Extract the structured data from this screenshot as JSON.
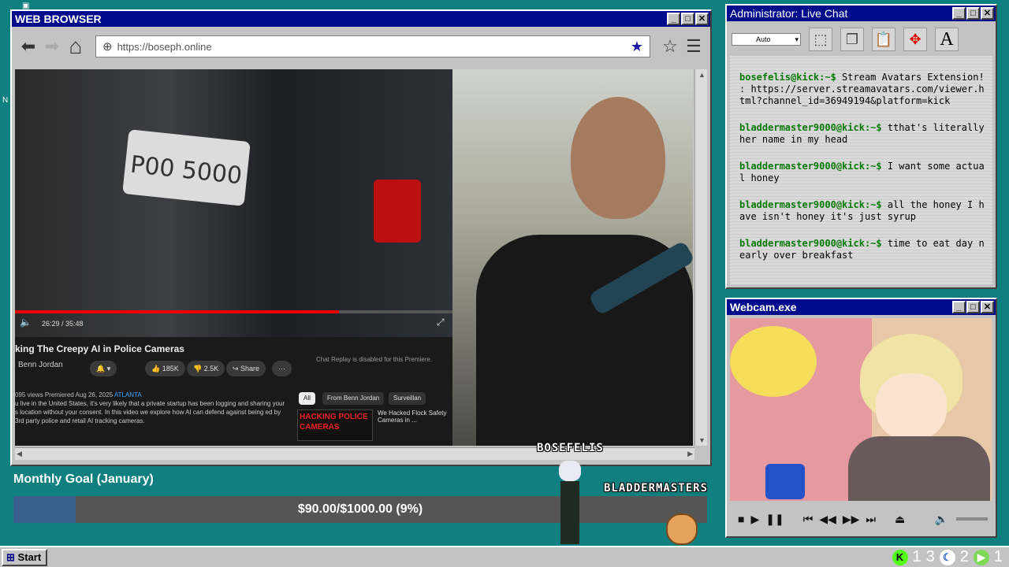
{
  "browser": {
    "title": "WEB BROWSER",
    "url": "https://boseph.online",
    "nav": {
      "back": "⬅",
      "forward": "➡",
      "home": "⌂"
    }
  },
  "video": {
    "plate_text": "P00 5000",
    "time": "26:29 / 35:48",
    "progress": 0.74,
    "title": "king The Creepy AI in Police Cameras",
    "channel": "Benn Jordan",
    "likes": "185K",
    "dislikes": "2.5K",
    "share": "Share",
    "chat_note": "Chat Replay is disabled for this Premiere.",
    "views": "095 views",
    "premiered": "Premiered Aug 26, 2025",
    "location": "ATLANTA",
    "description": "u live in the United States, it's very likely that a private startup has been logging and sharing your s location without your consent. In this video we explore how AI can defend against being ed by 3rd party police and retail AI tracking cameras.",
    "filters": [
      "All",
      "From Benn Jordan",
      "Surveillan"
    ],
    "thumb_text": "HACKING POLICE CAMERAS",
    "thumb_title": "We Hacked Flock Safety Cameras in ..."
  },
  "chat": {
    "title": "Administrator: Live Chat",
    "select_value": "Auto",
    "messages": [
      {
        "user": "bosefelis@kick:~$",
        "text": " Stream Avatars Extension! : https://server.streamavatars.com/viewer.html?channel_id=36949194&platform=kick"
      },
      {
        "user": "bladdermaster9000@kick:~$",
        "text": " tthat's literally her name in my head"
      },
      {
        "user": "bladdermaster9000@kick:~$",
        "text": " I want some actual honey"
      },
      {
        "user": "bladdermaster9000@kick:~$",
        "text": " all the honey I have isn't honey it's just syrup"
      },
      {
        "user": "bladdermaster9000@kick:~$",
        "text": " time to eat day nearly over breakfast"
      }
    ]
  },
  "webcam": {
    "title": "Webcam.exe"
  },
  "goal": {
    "title": "Monthly Goal (January)",
    "text": "$90.00/$1000.00 (9%)",
    "progress": 0.09
  },
  "avatars": {
    "a1": "BOSEFELIS",
    "a2": "BLADDERMASTERS"
  },
  "taskbar": {
    "start": "Start",
    "counts": [
      "1",
      "3",
      "2",
      "1"
    ]
  },
  "colors": {
    "desktop": "#0f7f7f",
    "titlebar": "#000c8c",
    "chat_user": "#067a06",
    "goal_fill": "#3a5f8f"
  }
}
